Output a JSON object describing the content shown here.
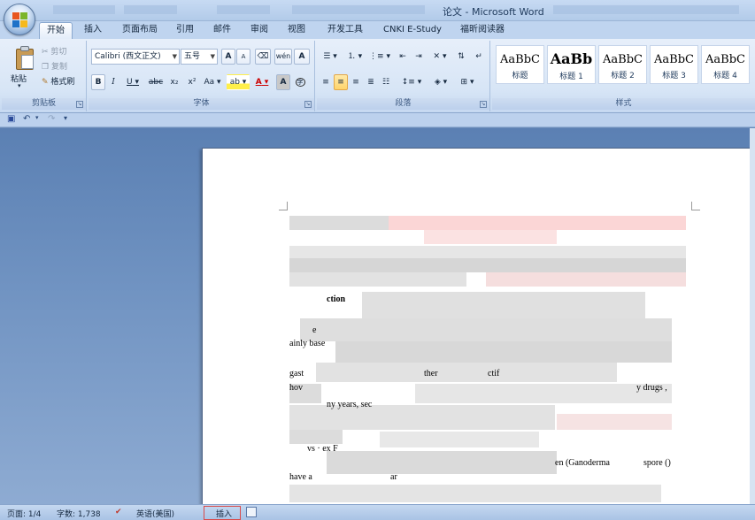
{
  "window": {
    "title": "论文 - Microsoft Word"
  },
  "ribbon_tabs": [
    "开始",
    "插入",
    "页面布局",
    "引用",
    "邮件",
    "审阅",
    "视图",
    "开发工具",
    "CNKI E-Study",
    "福昕阅读器"
  ],
  "clipboard": {
    "paste": "粘贴",
    "cut": "剪切",
    "copy": "复制",
    "format_painter": "格式刷",
    "group_label": "剪贴板"
  },
  "font": {
    "name": "Calibri (西文正文)",
    "size": "五号",
    "group_label": "字体",
    "grow": "A",
    "shrink": "A",
    "bold": "B",
    "italic": "I",
    "underline": "U",
    "strike": "abc",
    "subscript": "x₂",
    "superscript": "x²",
    "change_case": "Aa",
    "phonetic": "wén",
    "char_border": "A",
    "highlight": "ab",
    "font_color": "A",
    "char_shading": "A",
    "enclose": "字"
  },
  "paragraph": {
    "group_label": "段落"
  },
  "styles": {
    "group_label": "样式",
    "items": [
      {
        "sample": "AaBbC",
        "name": "标题"
      },
      {
        "sample": "AaBb",
        "name": "标题 1"
      },
      {
        "sample": "AaBbC",
        "name": "标题 2"
      },
      {
        "sample": "AaBbC",
        "name": "标题 3"
      },
      {
        "sample": "AaBbC",
        "name": "标题 4"
      }
    ]
  },
  "document_fragments": {
    "heading": "ction",
    "f2": "e",
    "f3": "ainly base",
    "f4": "gast",
    "f4b": "ther",
    "f4c": "ctif",
    "f5": "hov",
    "f5b": "y drugs ,",
    "f6": "ny years, sec",
    "f7": "vs · ex F",
    "f8": "en (Ganoderma",
    "f8b": "spore ()",
    "f9": "have a",
    "f9b": "ar"
  },
  "status": {
    "page": "页面: 1/4",
    "words": "字数: 1,738",
    "language": "英语(美国)",
    "mode": "插入"
  }
}
